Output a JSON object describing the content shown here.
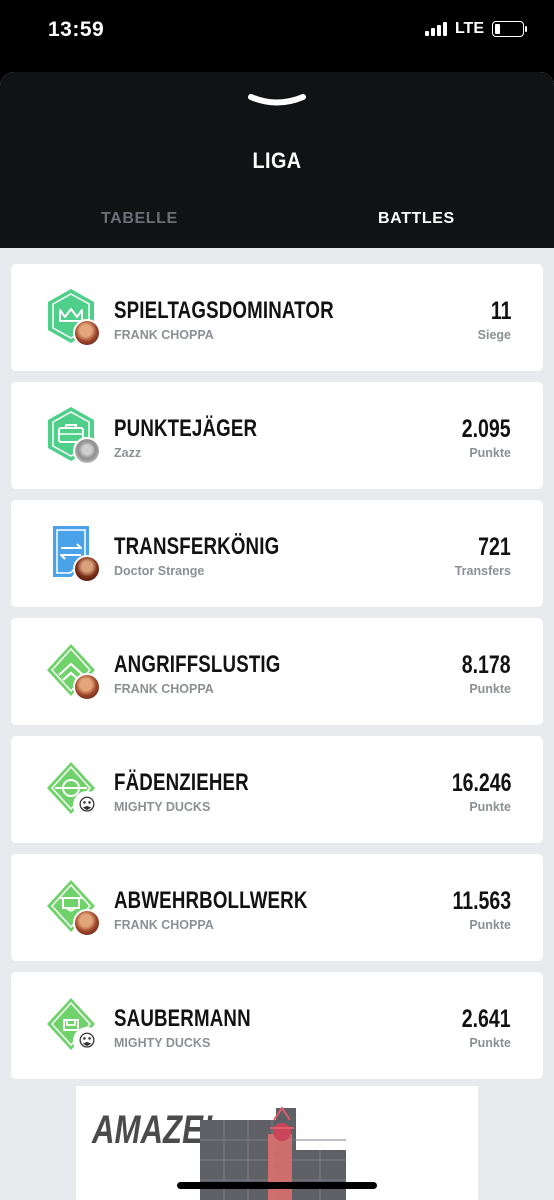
{
  "status_bar": {
    "time": "13:59",
    "network": "LTE",
    "icons": [
      "signal-icon",
      "battery-icon"
    ]
  },
  "header": {
    "title": "LIGA",
    "tabs": [
      {
        "label": "TABELLE",
        "active": false
      },
      {
        "label": "BATTLES",
        "active": true
      }
    ]
  },
  "battles": [
    {
      "title": "SPIELTAGSDOMINATOR",
      "user": "FRANK CHOPPA",
      "value": "11",
      "unit": "Siege",
      "badge": "crown-badge-icon",
      "badge_color": "#4fcf8a"
    },
    {
      "title": "PUNKTEJÄGER",
      "user": "Zazz",
      "value": "2.095",
      "unit": "Punkte",
      "badge": "briefcase-badge-icon",
      "badge_color": "#4fcf8a"
    },
    {
      "title": "TRANSFERKÖNIG",
      "user": "Doctor Strange",
      "value": "721",
      "unit": "Transfers",
      "badge": "transfer-badge-icon",
      "badge_color": "#4aa3e8"
    },
    {
      "title": "ANGRIFFSLUSTIG",
      "user": "FRANK CHOPPA",
      "value": "8.178",
      "unit": "Punkte",
      "badge": "attack-chevron-badge-icon",
      "badge_color": "#6fd26a"
    },
    {
      "title": "FÄDENZIEHER",
      "user": "MIGHTY DUCKS",
      "value": "16.246",
      "unit": "Punkte",
      "badge": "midfield-badge-icon",
      "badge_color": "#6fd26a"
    },
    {
      "title": "ABWEHRBOLLWERK",
      "user": "FRANK CHOPPA",
      "value": "11.563",
      "unit": "Punkte",
      "badge": "defense-badge-icon",
      "badge_color": "#6fd26a"
    },
    {
      "title": "SAUBERMANN",
      "user": "MIGHTY DUCKS",
      "value": "2.641",
      "unit": "Punkte",
      "badge": "goalkeeper-badge-icon",
      "badge_color": "#6fd26a"
    }
  ],
  "ad": {
    "text": "AMAZE!"
  }
}
